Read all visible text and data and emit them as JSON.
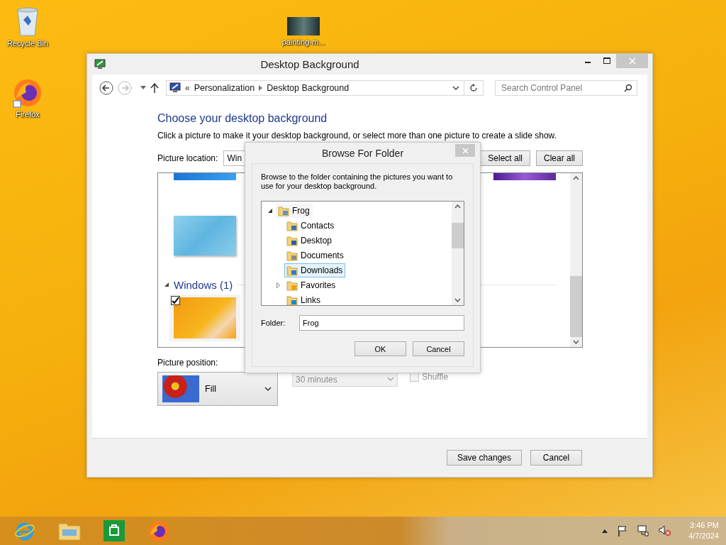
{
  "desktop_icons": [
    {
      "label": "Recycle Bin",
      "kind": "bin"
    },
    {
      "label": "Firefox",
      "kind": "firefox"
    },
    {
      "label": "painting-m...",
      "kind": "image"
    }
  ],
  "window": {
    "title": "Desktop Background",
    "address": {
      "overflow": "«",
      "crumbs": [
        "Personalization",
        "Desktop Background"
      ]
    },
    "search": {
      "placeholder": "Search Control Panel"
    },
    "heading": "Choose your desktop background",
    "description": "Click a picture to make it your desktop background, or select more than one picture to create a slide show.",
    "picture_location": {
      "label": "Picture location:",
      "value": "Win"
    },
    "select_all": "Select all",
    "clear_all": "Clear all",
    "group": {
      "label": "Windows (1)",
      "expanded": true,
      "items": [
        {
          "checked": true
        }
      ]
    },
    "picture_position": {
      "label": "Picture position:",
      "value": "Fill"
    },
    "interval": {
      "value": "30 minutes",
      "disabled": true
    },
    "shuffle": {
      "label": "Shuffle",
      "checked": false,
      "disabled": true
    },
    "buttons": [
      "Save changes",
      "Cancel"
    ]
  },
  "dialog": {
    "title": "Browse For Folder",
    "instructions": "Browse to the folder containing the pictures you want to use for your desktop background.",
    "tree": [
      {
        "label": "Frog",
        "kind": "user",
        "expanded": true,
        "selected": false,
        "children": [
          {
            "label": "Contacts",
            "kind": "contacts",
            "selected": false
          },
          {
            "label": "Desktop",
            "kind": "desktop",
            "selected": false
          },
          {
            "label": "Documents",
            "kind": "documents",
            "selected": false
          },
          {
            "label": "Downloads",
            "kind": "downloads",
            "selected": true
          },
          {
            "label": "Favorites",
            "kind": "favorites",
            "expanded": false,
            "selected": false
          },
          {
            "label": "Links",
            "kind": "links",
            "selected": false
          }
        ]
      }
    ],
    "folder": {
      "label": "Folder:",
      "value": "Frog"
    },
    "buttons": [
      "OK",
      "Cancel"
    ]
  },
  "taskbar": {
    "time": "3:46 PM",
    "date": "4/7/2024"
  }
}
